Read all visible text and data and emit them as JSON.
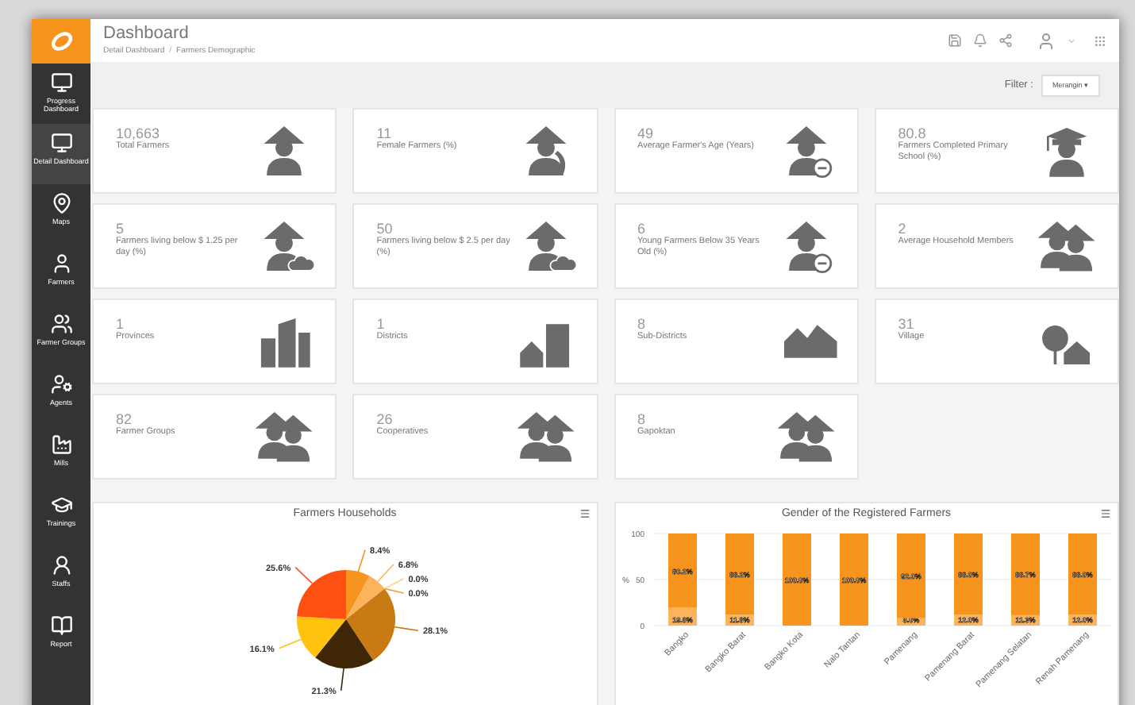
{
  "sidebar": {
    "items": [
      {
        "label": "Progress Dashboard",
        "kind": "monitor",
        "selected": false
      },
      {
        "label": "Detail Dashboard",
        "kind": "monitor",
        "selected": true
      },
      {
        "label": "Maps",
        "kind": "map",
        "selected": false
      },
      {
        "label": "Farmers",
        "kind": "farmer",
        "selected": false
      },
      {
        "label": "Farmer Groups",
        "kind": "group",
        "selected": false
      },
      {
        "label": "Agents",
        "kind": "agent",
        "selected": false
      },
      {
        "label": "Mills",
        "kind": "mill",
        "selected": false
      },
      {
        "label": "Trainings",
        "kind": "training",
        "selected": false
      },
      {
        "label": "Staffs",
        "kind": "staff",
        "selected": false
      },
      {
        "label": "Report",
        "kind": "report",
        "selected": false
      }
    ]
  },
  "header": {
    "title": "Dashboard",
    "breadcrumb": [
      "Detail Dashboard",
      "Farmers Demographic"
    ],
    "breadcrumb_separator": "/"
  },
  "filter": {
    "label": "Filter :",
    "value": "Merangin",
    "caret": "▾"
  },
  "cards": [
    {
      "value": "10,663",
      "label": "Total Farmers",
      "kind": "farmer"
    },
    {
      "value": "11",
      "label": "Female Farmers (%)",
      "kind": "female"
    },
    {
      "value": "49",
      "label": "Average Farmer's Age (Years)",
      "kind": "age"
    },
    {
      "value": "80.8",
      "label": "Farmers Completed Primary School (%)",
      "kind": "graduate"
    },
    {
      "value": "5",
      "label": "Farmers living below $ 1.25 per day (%)",
      "kind": "cloud"
    },
    {
      "value": "50",
      "label": "Farmers living below $ 2.5 per day (%)",
      "kind": "cloud"
    },
    {
      "value": "6",
      "label": "Young Farmers Below 35 Years Old (%)",
      "kind": "age"
    },
    {
      "value": "2",
      "label": "Average Household Members",
      "kind": "group"
    },
    {
      "value": "1",
      "label": "Provinces",
      "kind": "buildings"
    },
    {
      "value": "1",
      "label": "Districts",
      "kind": "house-building"
    },
    {
      "value": "8",
      "label": "Sub-Districts",
      "kind": "houses"
    },
    {
      "value": "31",
      "label": "Village",
      "kind": "tree-house"
    },
    {
      "value": "82",
      "label": "Farmer Groups",
      "kind": "group"
    },
    {
      "value": "26",
      "label": "Cooperatives",
      "kind": "group"
    },
    {
      "value": "8",
      "label": "Gapoktan",
      "kind": "group"
    }
  ],
  "pie_panel": {
    "chart_data": {
      "type": "pie",
      "title": "Farmers Households",
      "data_labels": true,
      "values": [
        8.4,
        6.8,
        0.0,
        0.0,
        28.1,
        21.3,
        16.1,
        25.6
      ],
      "value_labels": [
        "8.4%",
        "6.8%",
        "0.0%",
        "0.0%",
        "28.1%",
        "21.3%",
        "16.1%",
        "25.6%"
      ],
      "colors": [
        "#f7941d",
        "#fbb45c",
        "#fcd08c",
        "#e8a33c",
        "#c97a12",
        "#3e2606",
        "#ffc20e",
        "#ff5011"
      ]
    }
  },
  "bar_panel": {
    "chart_data": {
      "type": "bar",
      "title": "Gender of the Registered Farmers",
      "ylabel": "%",
      "stacked": true,
      "categories": [
        "Bangko",
        "Bangko Barat",
        "Bangko Kota",
        "Nalo Tantan",
        "Pamenang",
        "Pamenang Barat",
        "Pamenang Selatan",
        "Renah Pamenang"
      ],
      "yticks": [
        0,
        50,
        100
      ],
      "ylim": [
        0,
        100
      ],
      "series": [
        {
          "color": "#fbb45c",
          "values": [
            19.8,
            11.8,
            null,
            null,
            8.0,
            12.0,
            11.3,
            12.0
          ],
          "value_labels": [
            "19.8%",
            "11.8%",
            null,
            null,
            "8.0%",
            "12.0%",
            "11.3%",
            "12.0%"
          ]
        },
        {
          "color": "#f7941d",
          "values": [
            80.2,
            88.2,
            100.0,
            100.0,
            92.0,
            88.0,
            88.7,
            88.0
          ],
          "value_labels": [
            "80.2%",
            "88.2%",
            "100.0%",
            "100.0%",
            "92.0%",
            "88.0%",
            "88.7%",
            "88.0%"
          ]
        }
      ]
    }
  }
}
